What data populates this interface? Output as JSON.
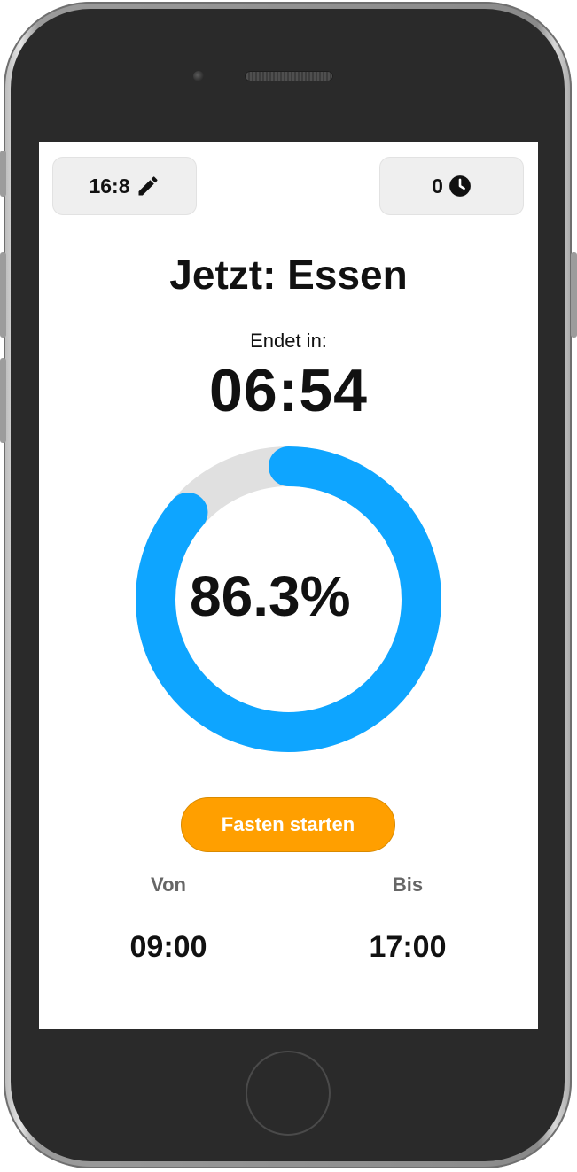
{
  "header": {
    "plan_label": "16:8",
    "plan_icon": "pencil-icon",
    "history_count": "0",
    "history_icon": "clock-icon"
  },
  "status": {
    "title": "Jetzt: Essen",
    "ends_label": "Endet in:",
    "countdown": "06:54"
  },
  "progress": {
    "percent_text": "86.3%",
    "fraction": 0.863,
    "color": "#0ea5ff",
    "track_color": "#e0e0e0"
  },
  "action": {
    "start_label": "Fasten starten",
    "color": "#ff9f00"
  },
  "window": {
    "from_label": "Von",
    "from_time": "09:00",
    "to_label": "Bis",
    "to_time": "17:00"
  }
}
